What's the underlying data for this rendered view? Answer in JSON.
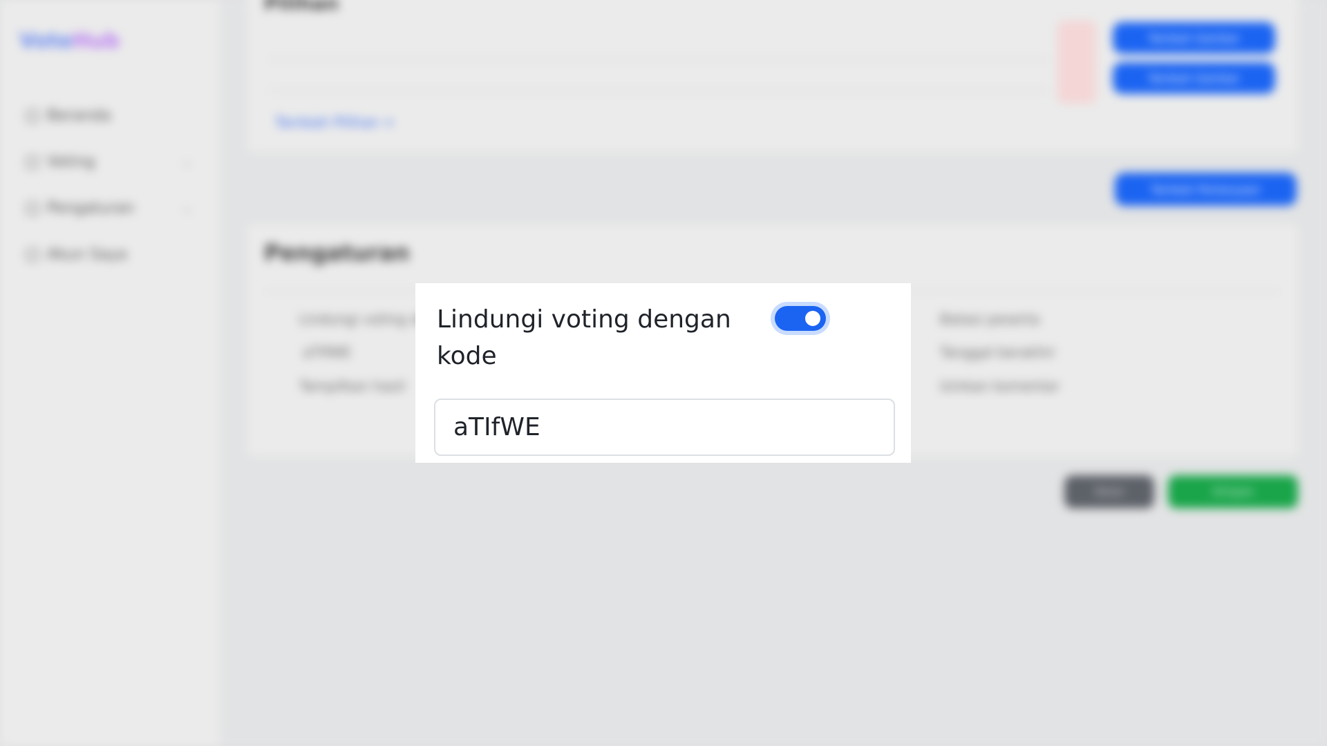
{
  "app": {
    "logo_primary": "Vote",
    "logo_accent": "Hub"
  },
  "sidebar": {
    "items": [
      {
        "label": "Beranda",
        "has_chevron": false
      },
      {
        "label": "Voting",
        "has_chevron": true
      },
      {
        "label": "Pengaturan",
        "has_chevron": true
      },
      {
        "label": "Akun Saya",
        "has_chevron": false
      }
    ]
  },
  "background": {
    "options_title": "Pilihan",
    "add_option_label": "Tambah Pilihan +",
    "option_button_1": "Tambah Gambar",
    "option_button_2": "Tambah Gambar",
    "add_question_button": "Tambah Pertanyaan",
    "settings_title": "Pengaturan",
    "setting_left_1": "Lindungi voting dengan",
    "setting_left_2": "aTIfWE",
    "setting_left_3": "Tampilkan hasil",
    "setting_right_1": "Batasi peserta",
    "setting_right_2": "Tanggal berakhir",
    "setting_right_3": "Izinkan komentar",
    "cancel_button": "Batal",
    "save_button": "Simpan"
  },
  "popup": {
    "label": "Lindungi voting dengan kode",
    "toggle_on": true,
    "code_value": "aTIfWE"
  },
  "colors": {
    "accent": "#1b64f2",
    "toggle_halo": "#c9dcfd",
    "text": "#1f2329",
    "input_border": "#dcdfe3"
  }
}
